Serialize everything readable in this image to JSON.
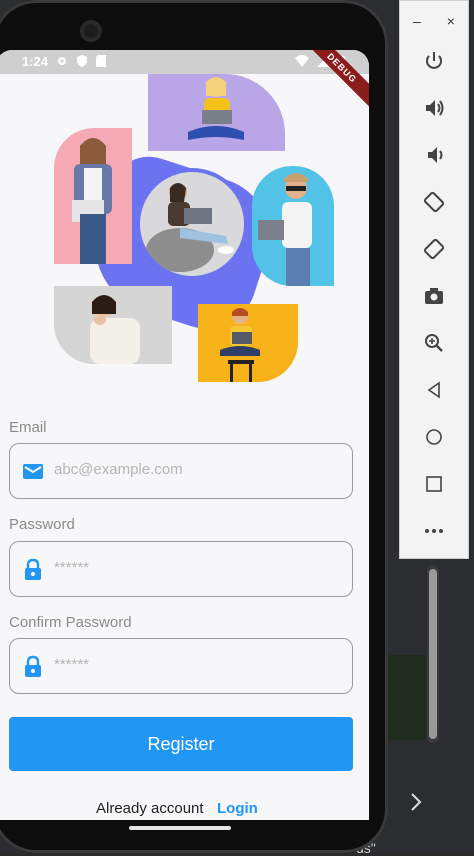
{
  "status_bar": {
    "time": "1:24",
    "ribbon": "DEBUG"
  },
  "form": {
    "email": {
      "label": "Email",
      "placeholder": "abc@example.com"
    },
    "password": {
      "label": "Password",
      "placeholder": "******"
    },
    "confirm": {
      "label": "Confirm Password",
      "placeholder": "******"
    },
    "register_label": "Register",
    "already_text": "Already account",
    "login_label": "Login"
  },
  "emulator": {
    "minimize": "–",
    "close": "×",
    "buttons": [
      "power-icon",
      "volume-up-icon",
      "volume-down-icon",
      "rotate-left-icon",
      "rotate-right-icon",
      "camera-icon",
      "zoom-icon",
      "back-icon",
      "home-icon",
      "overview-icon",
      "more-icon"
    ]
  },
  "ide": {
    "trailing_text": "ds\""
  },
  "colors": {
    "accent": "#2196f3",
    "hex_blob": "#6b73f0"
  }
}
